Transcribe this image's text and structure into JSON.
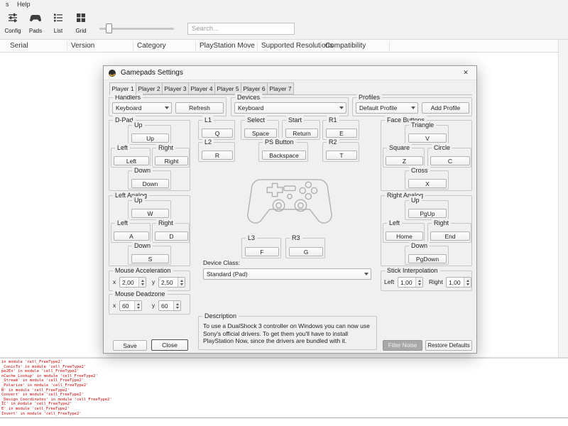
{
  "menubar": {
    "items": [
      "s",
      "Help"
    ]
  },
  "toolbar": {
    "buttons": [
      {
        "label": "Config"
      },
      {
        "label": "Pads"
      },
      {
        "label": "List"
      },
      {
        "label": "Grid"
      }
    ],
    "search": {
      "placeholder": "Search..."
    }
  },
  "game_list": {
    "columns": [
      "Serial",
      "Version",
      "Category",
      "PlayStation Move",
      "Supported Resolutions",
      "Compatibility"
    ]
  },
  "dialog": {
    "title": "Gamepads Settings",
    "tabs": [
      "Player 1",
      "Player 2",
      "Player 3",
      "Player 4",
      "Player 5",
      "Player 6",
      "Player 7"
    ],
    "handlers": {
      "title": "Handlers",
      "value": "Keyboard",
      "refresh_label": "Refresh"
    },
    "devices": {
      "title": "Devices",
      "value": "Keyboard"
    },
    "profiles": {
      "title": "Profiles",
      "value": "Default Profile",
      "add_label": "Add Profile"
    },
    "dpad": {
      "title": "D-Pad",
      "up": {
        "label": "Up",
        "key": "Up"
      },
      "left": {
        "label": "Left",
        "key": "Left"
      },
      "right": {
        "label": "Right",
        "key": "Right"
      },
      "down": {
        "label": "Down",
        "key": "Down"
      }
    },
    "left_analog": {
      "title": "Left Analog",
      "up": {
        "label": "Up",
        "key": "W"
      },
      "left": {
        "label": "Left",
        "key": "A"
      },
      "right": {
        "label": "Right",
        "key": "D"
      },
      "down": {
        "label": "Down",
        "key": "S"
      }
    },
    "triggers": {
      "l1": {
        "label": "L1",
        "key": "Q"
      },
      "l2": {
        "label": "L2",
        "key": "R"
      },
      "l3": {
        "label": "L3",
        "key": "F"
      },
      "r1": {
        "label": "R1",
        "key": "E"
      },
      "r2": {
        "label": "R2",
        "key": "T"
      },
      "r3": {
        "label": "R3",
        "key": "G"
      }
    },
    "select": {
      "label": "Select",
      "key": "Space"
    },
    "start": {
      "label": "Start",
      "key": "Return"
    },
    "ps_button": {
      "label": "PS Button",
      "key": "Backspace"
    },
    "face_buttons": {
      "title": "Face Buttons",
      "triangle": {
        "label": "Triangle",
        "key": "V"
      },
      "square": {
        "label": "Square",
        "key": "Z"
      },
      "circle": {
        "label": "Circle",
        "key": "C"
      },
      "cross": {
        "label": "Cross",
        "key": "X"
      }
    },
    "right_analog": {
      "title": "Right Analog",
      "up": {
        "label": "Up",
        "key": "PgUp"
      },
      "left": {
        "label": "Left",
        "key": "Home"
      },
      "right": {
        "label": "Right",
        "key": "End"
      },
      "down": {
        "label": "Down",
        "key": "PgDown"
      }
    },
    "device_class": {
      "label": "Device Class:",
      "value": "Standard (Pad)"
    },
    "mouse_acceleration": {
      "title": "Mouse Acceleration",
      "x_label": "x",
      "x_value": "2,00",
      "y_label": "y",
      "y_value": "2,50"
    },
    "mouse_deadzone": {
      "title": "Mouse Deadzone",
      "x_label": "x",
      "x_value": "60",
      "y_label": "y",
      "y_value": "60"
    },
    "stick_interpolation": {
      "title": "Stick Interpolation",
      "left_label": "Left",
      "left_value": "1,00",
      "right_label": "Right",
      "right_value": "1,00"
    },
    "description": {
      "title": "Description",
      "text": "To use a DualShock 3 controller on Windows you can now use Sony's official drivers. To get them you'll have to install PlayStation Now, since the drivers are bundled with it."
    },
    "footer": {
      "save": "Save",
      "close": "Close",
      "filter_noise": "Filter Noise",
      "restore_defaults": "Restore Defaults"
    }
  },
  "log": {
    "lines": [
      "in module 'cell_FreeType2'",
      "_ConicTo' in module 'cell_FreeType2'",
      "pe2Ex' in module 'cell_FreeType2'",
      "nCache_Lookup' in module 'cell_FreeType2'",
      "_Stream' in module 'cell_FreeType2'",
      "_Polarize' in module 'cell_FreeType2'",
      "B' in module 'cell_FreeType2'",
      "Convert' in module 'cell_FreeType2'",
      "_Design_Coordinates' in module 'cell_FreeType2'",
      "IC' in module 'cell_FreeType2'",
      "E' in module 'cell_FreeType2'",
      "Invert' in module 'cell_FreeType2'"
    ]
  },
  "icons": {
    "close": "✕"
  }
}
